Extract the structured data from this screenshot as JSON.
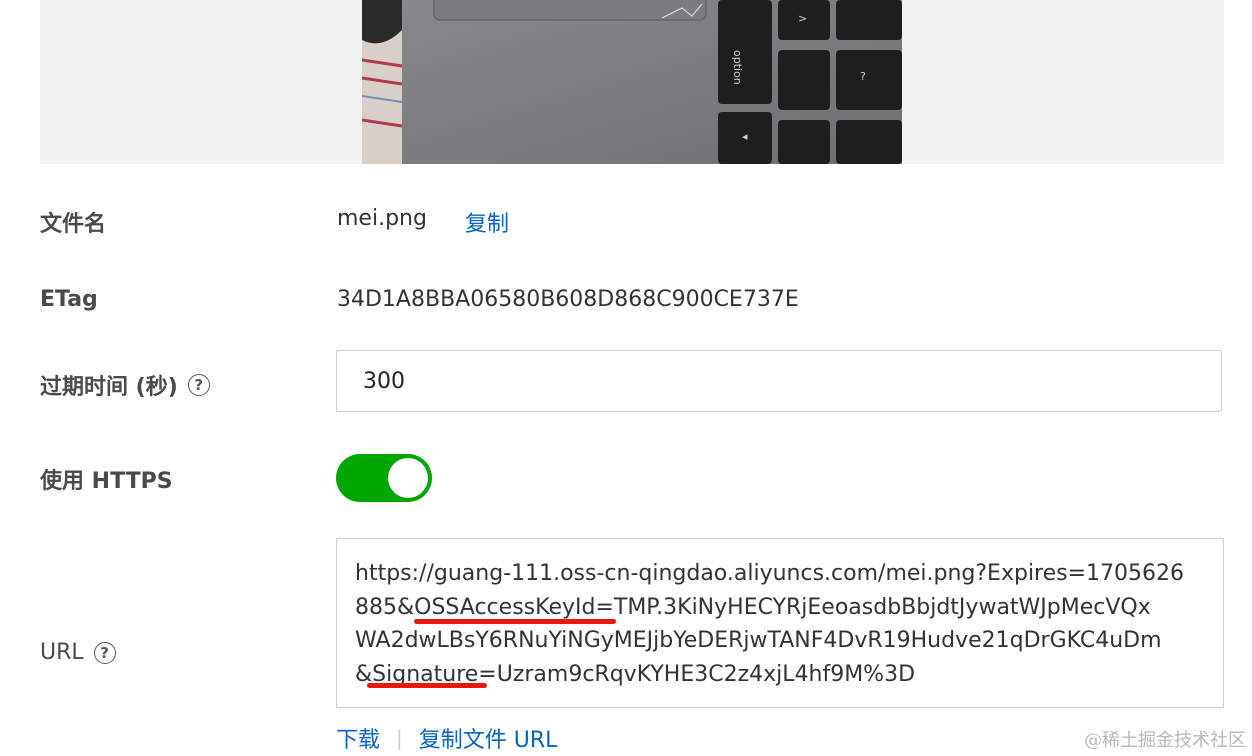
{
  "file_name": {
    "label": "文件名",
    "value": "mei.png",
    "copy_link": "复制"
  },
  "etag": {
    "label": "ETag",
    "value": "34D1A8BBA06580B608D868C900CE737E"
  },
  "expire": {
    "label": "过期时间 (秒)",
    "help_icon": "question-circle-icon",
    "value": "300"
  },
  "https": {
    "label": "使用 HTTPS",
    "enabled": true,
    "accent": "#00a700"
  },
  "url": {
    "label": "URL",
    "help_icon": "question-circle-icon",
    "lines": [
      "https://guang-111.oss-cn-qingdao.aliyuncs.com/mei.png?Expires=1705626",
      "885&OSSAccessKeyId=TMP.3KiNyHECYRjEeoasdbBbjdtJywatWJpMecVQx",
      "WA2dwLBsY6RNuYiNGyMEJjbYeDERjwTANF4DvR19Hudve21qDrGKC4uDm",
      "&Signature=Uzram9cRqvKYHE3C2z4xjL4hf9M%3D"
    ],
    "highlight_color": "#e8180f"
  },
  "actions": {
    "download": "下载",
    "copy_url": "复制文件 URL"
  },
  "watermark": "@稀土掘金技术社区",
  "colors": {
    "link": "#0064c8",
    "toggle_on": "#00a700"
  }
}
